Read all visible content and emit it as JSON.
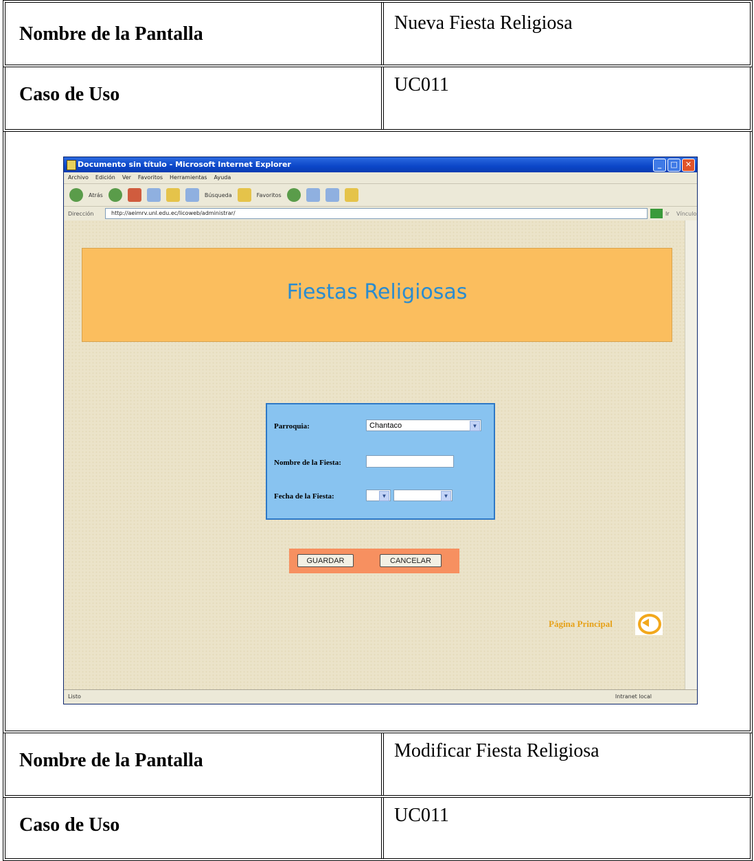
{
  "doc": {
    "rows": [
      {
        "label": "Nombre de la Pantalla",
        "value": "Nueva Fiesta Religiosa"
      },
      {
        "label": "Caso de Uso",
        "value": "UC011"
      },
      {
        "label": "Nombre de la Pantalla",
        "value": "Modificar Fiesta Religiosa"
      },
      {
        "label": "Caso de Uso",
        "value": "UC011"
      }
    ]
  },
  "browser": {
    "title": "Documento sin título - Microsoft Internet Explorer",
    "menu": [
      "Archivo",
      "Edición",
      "Ver",
      "Favoritos",
      "Herramientas",
      "Ayuda"
    ],
    "toolbar": {
      "back": "Atrás",
      "search": "Búsqueda",
      "favorites": "Favoritos"
    },
    "address_label": "Dirección",
    "address_url": "http://aeimrv.unl.edu.ec/licoweb/administrar/",
    "go_label": "Ir",
    "links_label": "Vínculos",
    "status_left": "Listo",
    "status_right": "Intranet local"
  },
  "page": {
    "banner_title": "Fiestas Religiosas",
    "form": {
      "parroquia_label": "Parroquia:",
      "parroquia_value": "Chantaco",
      "nombre_label": "Nombre de la Fiesta:",
      "nombre_value": "",
      "fecha_label": "Fecha de la Fiesta:"
    },
    "buttons": {
      "save": "GUARDAR",
      "cancel": "CANCELAR"
    },
    "home_link": "Página Principal"
  },
  "colors": {
    "banner": "#fbbe5e",
    "form_bg": "#88c3f0",
    "button_bar": "#f79060",
    "home_text": "#e6a118"
  }
}
